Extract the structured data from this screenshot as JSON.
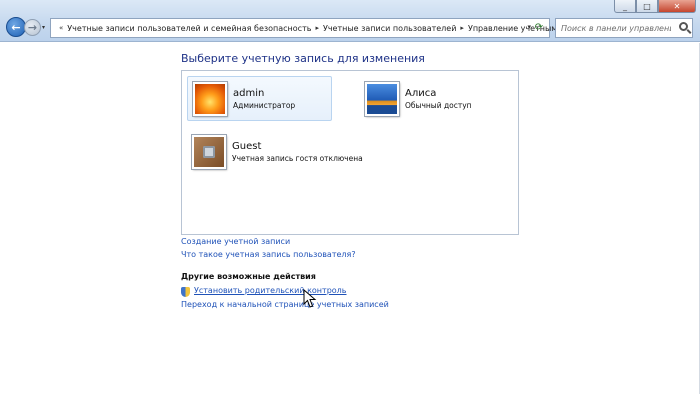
{
  "window": {
    "min_label": "_",
    "max_label": "□",
    "close_label": "✕"
  },
  "nav": {
    "back_label": "←",
    "forward_label": "→",
    "history_label": "▾"
  },
  "address": {
    "prefix": "«",
    "separator": "▸",
    "crumbs": [
      "Учетные записи пользователей и семейная безопасность",
      "Учетные записи пользователей",
      "Управление учетными записями"
    ],
    "dropdown_label": "▾",
    "refresh_label": "⟳"
  },
  "search": {
    "placeholder": "Поиск в панели управления"
  },
  "main": {
    "heading": "Выберите учетную запись для изменения",
    "accounts": [
      {
        "name": "admin",
        "type": "Администратор",
        "icon": "orange-flower-avatar",
        "selected": true
      },
      {
        "name": "Алиса",
        "type": "Обычный доступ",
        "icon": "fish-avatar",
        "selected": false
      },
      {
        "name": "Guest",
        "type": "Учетная запись гостя отключена",
        "icon": "briefcase-avatar",
        "selected": false
      }
    ],
    "links": {
      "create_account": "Создание учетной записи",
      "what_is_account": "Что такое учетная запись пользователя?"
    },
    "other_actions": {
      "title": "Другие возможные действия",
      "parental_control": "Установить родительский контроль",
      "home_page": "Переход к начальной странице учетных записей"
    }
  },
  "colors": {
    "link": "#1f52b8",
    "heading": "#1e3287",
    "chrome": "#c5d8ee"
  }
}
